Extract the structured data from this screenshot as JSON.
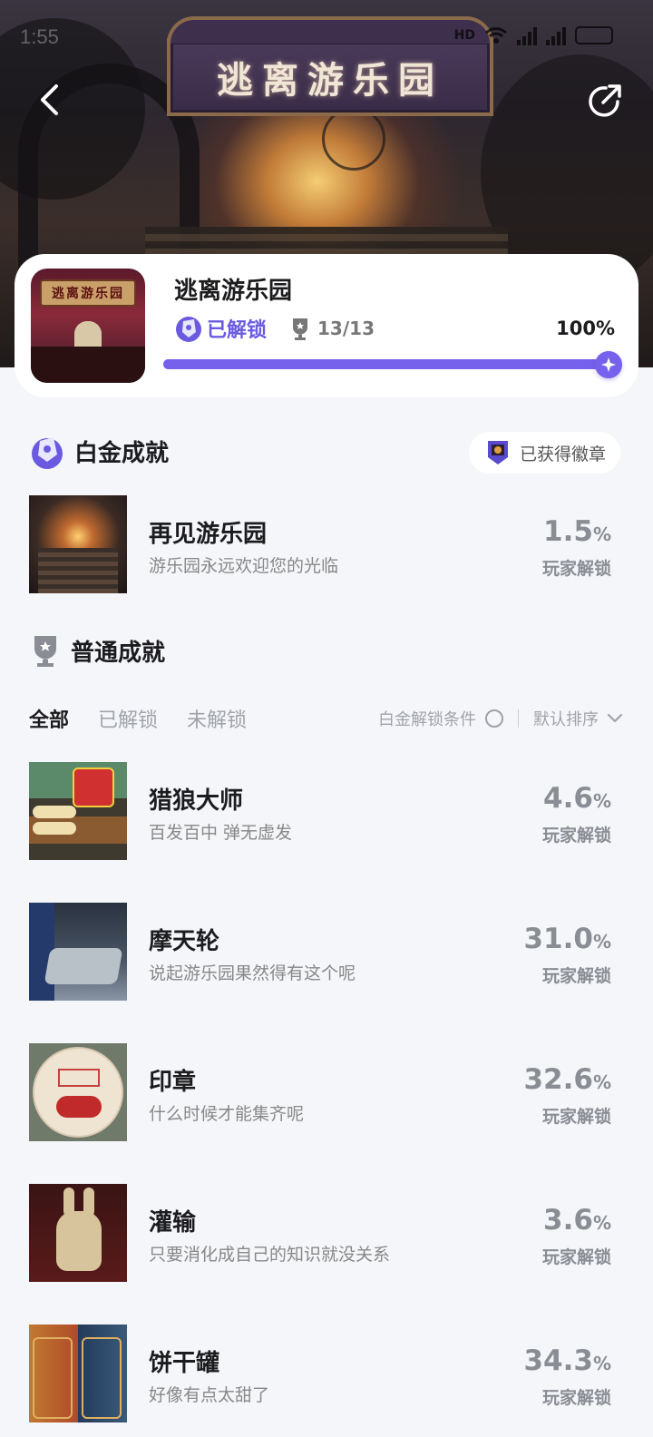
{
  "status_bar": {
    "time": "1:55"
  },
  "hero": {
    "sign_text": "逃离游乐园"
  },
  "game": {
    "title": "逃离游乐园",
    "cover_text": "逃离游乐园",
    "unlock_label": "已解锁",
    "trophy_count": "13/13",
    "percent": "100%",
    "progress": 1.0
  },
  "platinum": {
    "section_title": "白金成就",
    "badge_label": "已获得徽章",
    "item": {
      "name": "再见游乐园",
      "desc": "游乐园永远欢迎您的光临",
      "pct": "1.5",
      "unit": "%",
      "sub": "玩家解锁"
    }
  },
  "normal": {
    "section_title": "普通成就",
    "tabs": [
      "全部",
      "已解锁",
      "未解锁"
    ],
    "condition_label": "白金解锁条件",
    "sort_label": "默认排序",
    "items": [
      {
        "name": "猎狼大师",
        "desc": "百发百中 弹无虚发",
        "pct": "4.6",
        "unit": "%",
        "sub": "玩家解锁"
      },
      {
        "name": "摩天轮",
        "desc": "说起游乐园果然得有这个呢",
        "pct": "31.0",
        "unit": "%",
        "sub": "玩家解锁"
      },
      {
        "name": "印章",
        "desc": "什么时候才能集齐呢",
        "pct": "32.6",
        "unit": "%",
        "sub": "玩家解锁"
      },
      {
        "name": "灌输",
        "desc": "只要消化成自己的知识就没关系",
        "pct": "3.6",
        "unit": "%",
        "sub": "玩家解锁"
      },
      {
        "name": "饼干罐",
        "desc": "好像有点太甜了",
        "pct": "34.3",
        "unit": "%",
        "sub": "玩家解锁"
      }
    ]
  },
  "colors": {
    "accent": "#7561ec",
    "background": "#f5f6f9",
    "muted": "#8a8d94"
  },
  "icons": {
    "back": "chevron-left-icon",
    "share": "share-icon",
    "platinum": "platinum-trophy-icon",
    "trophy": "trophy-icon",
    "badge": "badge-icon",
    "sort": "chevron-down-icon"
  }
}
